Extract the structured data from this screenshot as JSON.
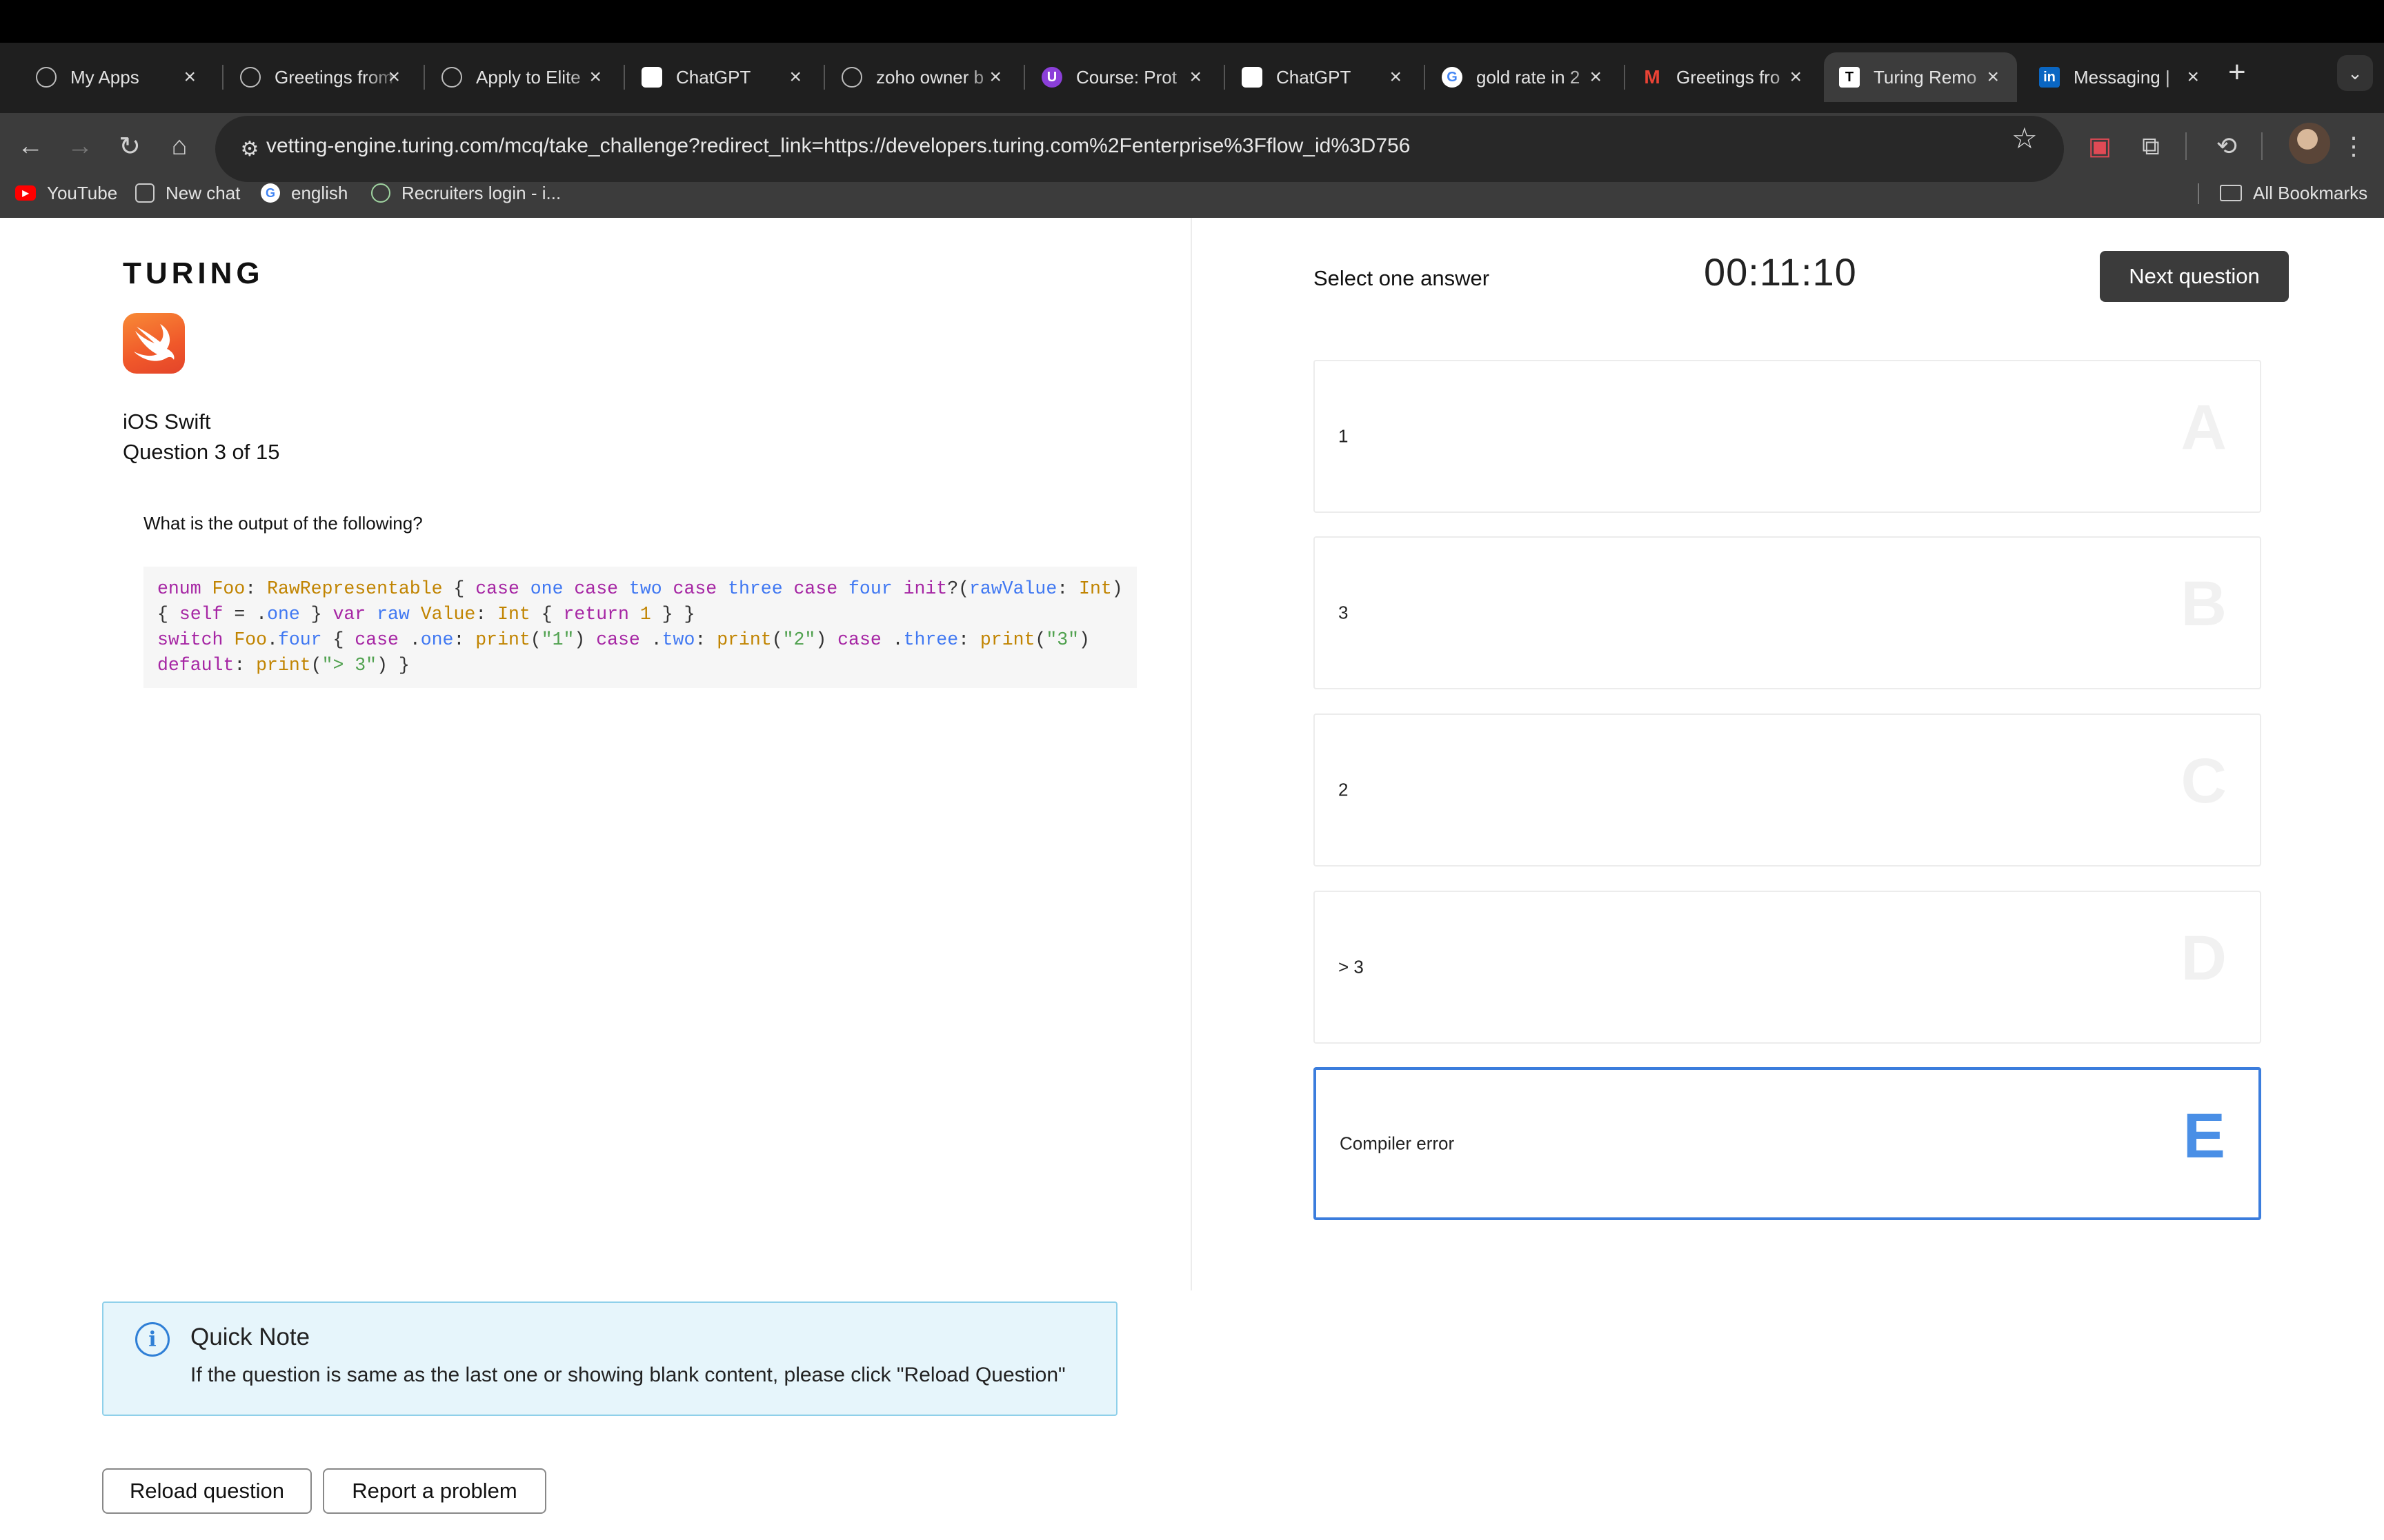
{
  "browser": {
    "tabs": [
      {
        "label": "My Apps",
        "icon": "apps-icon"
      },
      {
        "label": "Greetings from",
        "icon": "chatgpt-icon"
      },
      {
        "label": "Apply to Elite",
        "icon": "turing-icon"
      },
      {
        "label": "ChatGPT",
        "icon": "chatgpt-icon"
      },
      {
        "label": "zoho owner b",
        "icon": "perplexity-icon"
      },
      {
        "label": "Course: Prot",
        "icon": "course-icon"
      },
      {
        "label": "ChatGPT",
        "icon": "chatgpt-icon"
      },
      {
        "label": "gold rate in 2",
        "icon": "google-icon"
      },
      {
        "label": "Greetings fro",
        "icon": "gmail-icon"
      },
      {
        "label": "Turing Remo",
        "icon": "turing-icon"
      },
      {
        "label": "Messaging |",
        "icon": "linkedin-icon"
      }
    ],
    "new_tab": "+",
    "url": "vetting-engine.turing.com/mcq/take_challenge?redirect_link=https://developers.turing.com%2Fenterprise%3Fflow_id%3D756",
    "bookmarks": [
      {
        "label": "YouTube"
      },
      {
        "label": "New chat"
      },
      {
        "label": "english"
      },
      {
        "label": "Recruiters login - i..."
      }
    ],
    "all_bookmarks": "All Bookmarks"
  },
  "question_panel": {
    "brand": "TURING",
    "topic": "iOS Swift",
    "progress": "Question 3 of 15",
    "question": "What is the output of the following?",
    "code_lines": [
      "enum Foo: RawRepresentable { case one case two case three case four init?(rawValue: Int)",
      "{ self = .one } var raw Value: Int { return 1 } }",
      "switch Foo.four { case .one: print(\"1\") case .two: print(\"2\") case .three: print(\"3\")",
      "default: print(\"> 3\") }"
    ]
  },
  "note": {
    "title": "Quick Note",
    "body": "If the question is same as the last one or showing blank content, please click \"Reload Question\""
  },
  "actions": {
    "reload": "Reload question",
    "report": "Report a problem"
  },
  "answer_panel": {
    "instruction": "Select one answer",
    "timer": "00:11:10",
    "next": "Next question",
    "selected": "E",
    "options": [
      {
        "letter": "A",
        "text": "1"
      },
      {
        "letter": "B",
        "text": "3"
      },
      {
        "letter": "C",
        "text": "2"
      },
      {
        "letter": "D",
        "text": "> 3"
      },
      {
        "letter": "E",
        "text": "Compiler error"
      }
    ]
  },
  "colors": {
    "selected_border": "#3b7ddd",
    "note_background": "#e6f5fb",
    "next_button": "#3b3b3b"
  }
}
